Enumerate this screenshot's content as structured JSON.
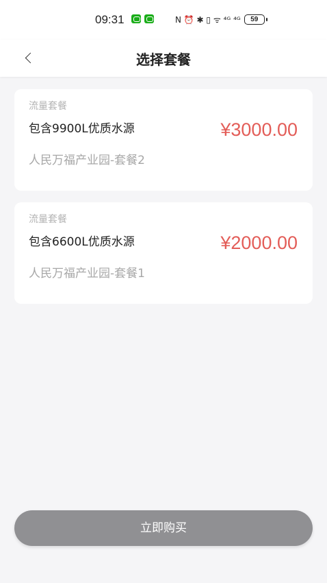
{
  "status_bar": {
    "time": "09:31",
    "icons_text": "N ⏰ ✱ ▯ ᯤ ⁴ᴳ ⁴ᴳ",
    "battery": "59"
  },
  "nav": {
    "title": "选择套餐"
  },
  "packages": [
    {
      "tag": "流量套餐",
      "volume": "包含9900L优质水源",
      "park": "人民万福产业园-套餐2",
      "price": "¥3000.00"
    },
    {
      "tag": "流量套餐",
      "volume": "包含6600L优质水源",
      "park": "人民万福产业园-套餐1",
      "price": "¥2000.00"
    }
  ],
  "buy_button": {
    "label": "立即购买"
  },
  "colors": {
    "price": "#e35d58",
    "button": "#909093",
    "background": "#f5f5f7"
  }
}
